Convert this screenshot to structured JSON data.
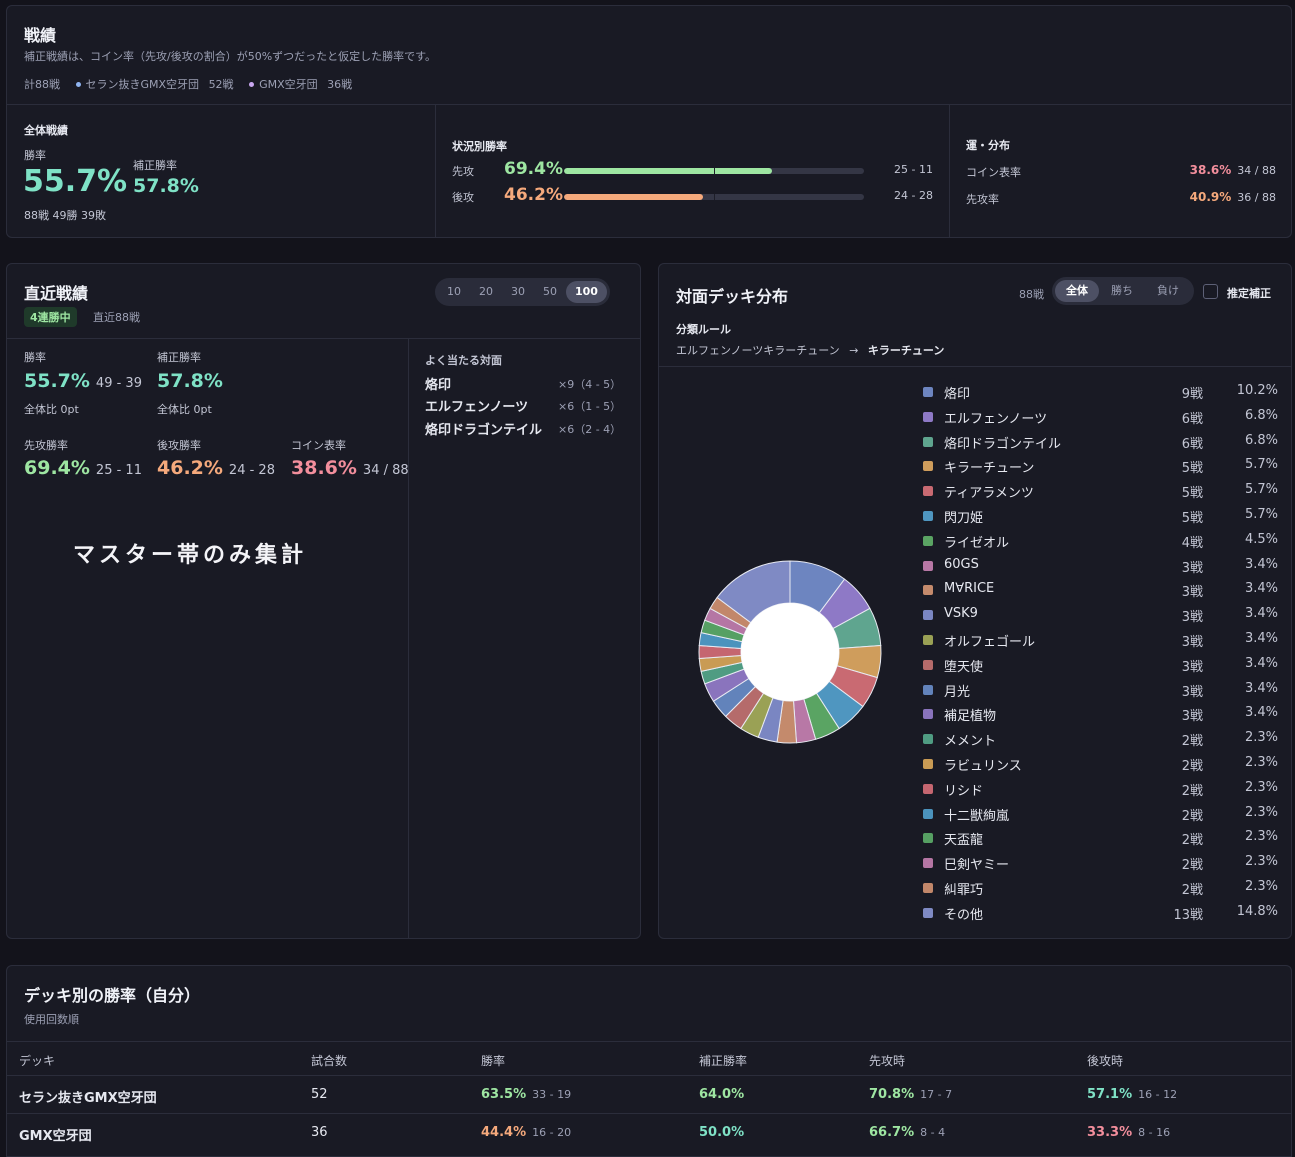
{
  "summary": {
    "title": "戦績",
    "note": "補正戦績は、コイン率（先攻/後攻の割合）が50%ずつだったと仮定した勝率です。",
    "total": "計88戦",
    "decks": [
      {
        "name": "セラン抜きGMX空牙団",
        "count": "52戦",
        "color": "#8fb4f0"
      },
      {
        "name": "GMX空牙団",
        "count": "36戦",
        "color": "#c9a7f0"
      }
    ],
    "overall": {
      "title": "全体戦績",
      "winrate_label": "勝率",
      "winrate": "55.7%",
      "corrected_label": "補正勝率",
      "corrected": "57.8%",
      "record": "88戦 49勝 39敗"
    },
    "situation": {
      "title": "状況別勝率",
      "rows": [
        {
          "label": "先攻",
          "value": "69.4%",
          "fraction": 0.694,
          "record": "25 - 11",
          "color": "#9ee6a2"
        },
        {
          "label": "後攻",
          "value": "46.2%",
          "fraction": 0.462,
          "record": "24 - 28",
          "color": "#f5a97c"
        }
      ]
    },
    "luck": {
      "title": "運・分布",
      "rows": [
        {
          "label": "コイン表率",
          "value": "38.6%",
          "detail": "34 / 88",
          "color": "#f28e9c"
        },
        {
          "label": "先攻率",
          "value": "40.9%",
          "detail": "36 / 88",
          "color": "#f5a97c"
        }
      ]
    }
  },
  "recent": {
    "title": "直近戦績",
    "streak": "4連勝中",
    "range_label": "直近88戦",
    "segments": [
      "10",
      "20",
      "30",
      "50",
      "100"
    ],
    "active_segment": "100",
    "winrate_label": "勝率",
    "winrate": "55.7%",
    "winrate_record": "49 - 39",
    "winrate_delta": "全体比 0pt",
    "corrected_label": "補正勝率",
    "corrected": "57.8%",
    "corrected_delta": "全体比 0pt",
    "first_label": "先攻勝率",
    "first": "69.4%",
    "first_record": "25 - 11",
    "second_label": "後攻勝率",
    "second": "46.2%",
    "second_record": "24 - 28",
    "coin_label": "コイン表率",
    "coin": "38.6%",
    "coin_record": "34 / 88",
    "note": "マスター帯のみ集計",
    "frequent_title": "よく当たる対面",
    "frequent": [
      {
        "name": "烙印",
        "detail": "×9（4 - 5）"
      },
      {
        "name": "エルフェンノーツ",
        "detail": "×6（1 - 5）"
      },
      {
        "name": "烙印ドラゴンテイル",
        "detail": "×6（2 - 4）"
      }
    ]
  },
  "distribution": {
    "title": "対面デッキ分布",
    "total": "88戦",
    "filters": [
      "全体",
      "勝ち",
      "負け"
    ],
    "active_filter": "全体",
    "checkbox_label": "推定補正",
    "rule_title": "分類ルール",
    "rule_from": "エルフェンノーツキラーチューン",
    "rule_arrow": "→",
    "rule_to": "キラーチューン"
  },
  "chart_data": {
    "type": "pie",
    "donut": true,
    "total": 88,
    "slices": [
      {
        "label": "烙印",
        "count": 9,
        "count_label": "9戦",
        "percent": "10.2%",
        "color": "#6d85c0"
      },
      {
        "label": "エルフェンノーツ",
        "count": 6,
        "count_label": "6戦",
        "percent": "6.8%",
        "color": "#8e79c6"
      },
      {
        "label": "烙印ドラゴンテイル",
        "count": 6,
        "count_label": "6戦",
        "percent": "6.8%",
        "color": "#5fa58f"
      },
      {
        "label": "キラーチューン",
        "count": 5,
        "count_label": "5戦",
        "percent": "5.7%",
        "color": "#cf9d5c"
      },
      {
        "label": "ティアラメンツ",
        "count": 5,
        "count_label": "5戦",
        "percent": "5.7%",
        "color": "#c96a72"
      },
      {
        "label": "閃刀姫",
        "count": 5,
        "count_label": "5戦",
        "percent": "5.7%",
        "color": "#4f96c0"
      },
      {
        "label": "ライゼオル",
        "count": 4,
        "count_label": "4戦",
        "percent": "4.5%",
        "color": "#5aa463"
      },
      {
        "label": "60GS",
        "count": 3,
        "count_label": "3戦",
        "percent": "3.4%",
        "color": "#b878a6"
      },
      {
        "label": "M∀RICE",
        "count": 3,
        "count_label": "3戦",
        "percent": "3.4%",
        "color": "#c48a6c"
      },
      {
        "label": "VSK9",
        "count": 3,
        "count_label": "3戦",
        "percent": "3.4%",
        "color": "#7a86c2"
      },
      {
        "label": "オルフェゴール",
        "count": 3,
        "count_label": "3戦",
        "percent": "3.4%",
        "color": "#9aa155"
      },
      {
        "label": "堕天使",
        "count": 3,
        "count_label": "3戦",
        "percent": "3.4%",
        "color": "#b56b6b"
      },
      {
        "label": "月光",
        "count": 3,
        "count_label": "3戦",
        "percent": "3.4%",
        "color": "#6283bb"
      },
      {
        "label": "補足植物",
        "count": 3,
        "count_label": "3戦",
        "percent": "3.4%",
        "color": "#8a74bd"
      },
      {
        "label": "メメント",
        "count": 2,
        "count_label": "2戦",
        "percent": "2.3%",
        "color": "#4f9c82"
      },
      {
        "label": "ラビュリンス",
        "count": 2,
        "count_label": "2戦",
        "percent": "2.3%",
        "color": "#c99b54"
      },
      {
        "label": "リシド",
        "count": 2,
        "count_label": "2戦",
        "percent": "2.3%",
        "color": "#c56670"
      },
      {
        "label": "十二獣絢嵐",
        "count": 2,
        "count_label": "2戦",
        "percent": "2.3%",
        "color": "#4b93bd"
      },
      {
        "label": "天盃龍",
        "count": 2,
        "count_label": "2戦",
        "percent": "2.3%",
        "color": "#56a063"
      },
      {
        "label": "巳剣ヤミー",
        "count": 2,
        "count_label": "2戦",
        "percent": "2.3%",
        "color": "#b576a4"
      },
      {
        "label": "糾罪巧",
        "count": 2,
        "count_label": "2戦",
        "percent": "2.3%",
        "color": "#c2876a"
      },
      {
        "label": "その他",
        "count": 13,
        "count_label": "13戦",
        "percent": "14.8%",
        "color": "#7f8ac4"
      }
    ]
  },
  "deck_table": {
    "title": "デッキ別の勝率（自分）",
    "subtitle": "使用回数順",
    "headers": [
      "デッキ",
      "試合数",
      "勝率",
      "補正勝率",
      "先攻時",
      "後攻時"
    ],
    "rows": [
      {
        "deck": "セラン抜きGMX空牙団",
        "games": "52",
        "winrate": "63.5%",
        "winrate_record": "33 - 19",
        "winrate_color": "#9ee6a2",
        "corrected": "64.0%",
        "corrected_color": "#9ee6a2",
        "first": "70.8%",
        "first_record": "17 - 7",
        "first_color": "#9ee6a2",
        "second": "57.1%",
        "second_record": "16 - 12",
        "second_color": "#7fe2c6"
      },
      {
        "deck": "GMX空牙団",
        "games": "36",
        "winrate": "44.4%",
        "winrate_record": "16 - 20",
        "winrate_color": "#f5a97c",
        "corrected": "50.0%",
        "corrected_color": "#7fe2c6",
        "first": "66.7%",
        "first_record": "8 - 4",
        "first_color": "#9ee6a2",
        "second": "33.3%",
        "second_record": "8 - 16",
        "second_color": "#f28e9c"
      }
    ]
  }
}
